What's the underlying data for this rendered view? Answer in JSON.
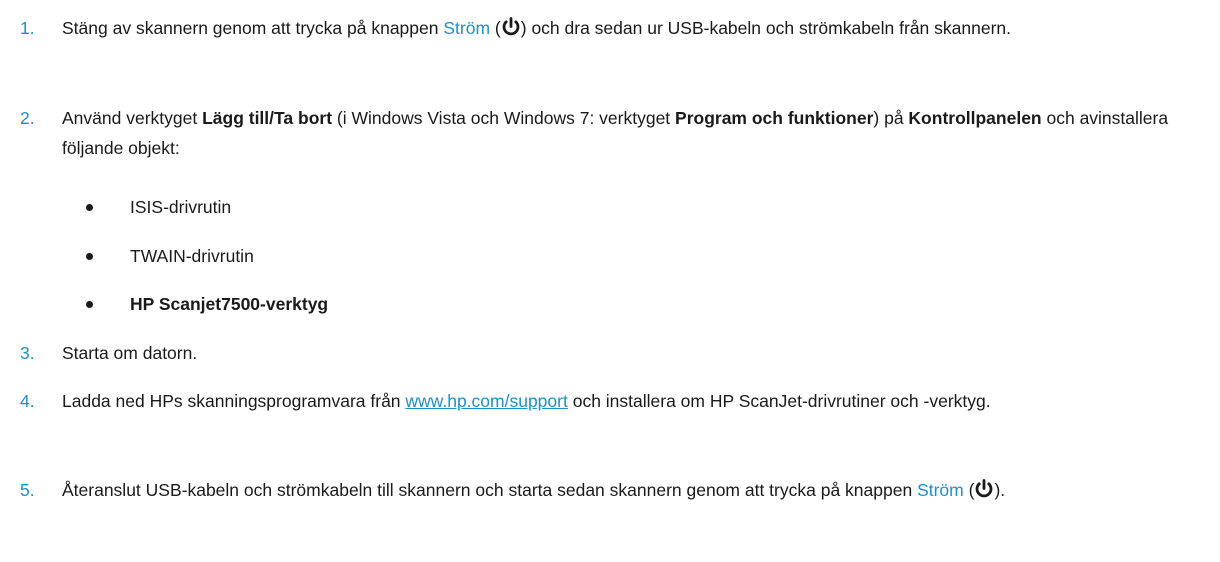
{
  "accent_color": "#1d90c8",
  "steps": [
    {
      "number": "1.",
      "t1": "Stäng av skannern genom att trycka på knappen ",
      "power_label": "Ström",
      "t2": " (",
      "t3": ") och dra sedan ur USB-kabeln och strömkabeln från skannern."
    },
    {
      "number": "2.",
      "t1": "Använd verktyget ",
      "b1": "Lägg till/Ta bort",
      "t2": " (i Windows Vista och Windows 7: verktyget ",
      "b2": "Program och funktioner",
      "t3": ") på ",
      "b3": "Kontrollpanelen",
      "t4": " och avinstallera följande objekt:",
      "items": [
        {
          "text": "ISIS-drivrutin"
        },
        {
          "text": "TWAIN-drivrutin"
        },
        {
          "text": "HP Scanjet7500-verktyg"
        }
      ]
    },
    {
      "number": "3.",
      "t1": "Starta om datorn."
    },
    {
      "number": "4.",
      "t1": "Ladda ned HPs skanningsprogramvara från ",
      "link": "www.hp.com/support",
      "t2": " och installera om HP ScanJet-drivrutiner och -verktyg."
    },
    {
      "number": "5.",
      "t1": "Återanslut USB-kabeln och strömkabeln till skannern och starta sedan skannern genom att trycka på knappen ",
      "power_label": "Ström",
      "t2": " (",
      "t3": ")."
    }
  ]
}
